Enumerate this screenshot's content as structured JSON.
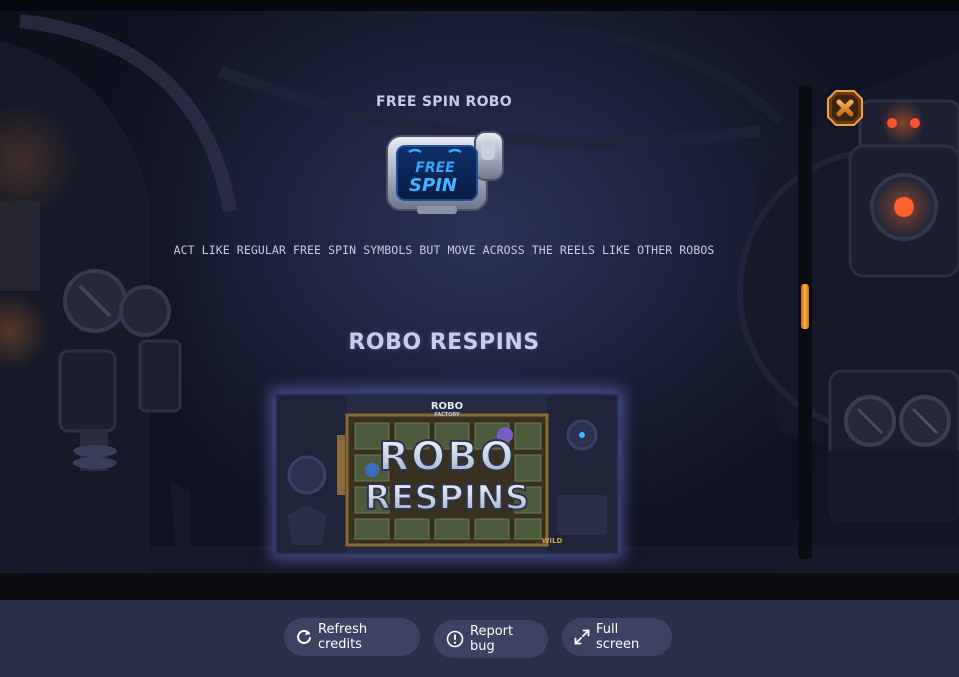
{
  "paytable": {
    "free_spin_robo": {
      "title": "FREE SPIN ROBO",
      "symbol_text_line1": "FREE",
      "symbol_text_line2": "SPIN",
      "description": "ACT LIKE REGULAR FREE SPIN SYMBOLS BUT MOVE ACROSS THE REELS LIKE OTHER ROBOS"
    },
    "robo_respins": {
      "title": "ROBO RESPINS",
      "image_logo_line1": "ROBO",
      "image_logo_line2": "FACTORY",
      "image_text_line1": "ROBO",
      "image_text_line2": "RESPINS",
      "image_wild_label": "WILD"
    },
    "scroll_position": 0.43
  },
  "toolbar": {
    "refresh_label": "Refresh credits",
    "report_label": "Report bug",
    "fullscreen_label": "Full screen"
  },
  "colors": {
    "accent_orange": "#f29a2e",
    "button_bg": "#3c4262",
    "bottom_bar_bg": "#2a2f48",
    "text_light": "#c7cbe6",
    "symbol_blue": "#2fa8ff"
  },
  "icons": {
    "close": "close-icon",
    "refresh": "refresh-icon",
    "report": "alert-circle-icon",
    "fullscreen": "expand-icon"
  }
}
